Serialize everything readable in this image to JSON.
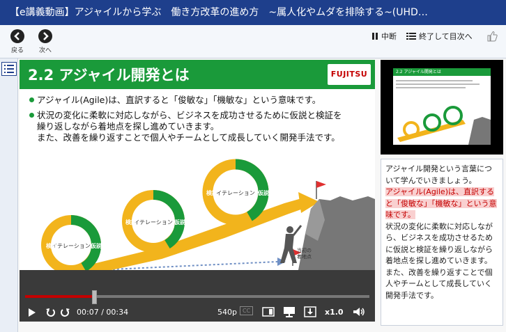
{
  "window": {
    "title": "【e講義動画】アジャイルから学ぶ　働き方改革の進め方　~属人化やムダを排除する~(UHD…"
  },
  "toolbar": {
    "back_label": "戻る",
    "next_label": "次へ",
    "pause_label": "中断",
    "toc_label": "終了して目次へ"
  },
  "slide": {
    "title": "2.2 アジャイル開発とは",
    "logo": "FUJITSU",
    "bullet1": "アジャイル(Agile)は、直訳すると「俊敏な」「機敏な」という意味です。",
    "bullet2_line1": "状況の変化に柔軟に対応しながら、ビジネスを成功させるために仮説と検証を",
    "bullet2_line2": "繰り返しながら着地点を探し進めていきます。",
    "bullet2_line3": "また、改善を繰り返すことで個人やチームとして成長していく開発手法です。",
    "loop_center": "イテレーション",
    "loop_left": "検証",
    "loop_right": "仮説",
    "goal_label_1": "当初の",
    "goal_label_2": "着地点"
  },
  "player": {
    "current_time": "00:07",
    "separator": " / ",
    "total_time": "00:34",
    "quality": "540p",
    "cc": "CC",
    "speed": "x1.0",
    "progress_fraction": 0.2
  },
  "transcript": {
    "line1": "アジャイル開発という言葉について学んでいきましょう。",
    "highlight": "アジャイル(Agile)は、直訳すると「俊敏な」「機敏な」という意味です。",
    "rest": "状況の変化に柔軟に対応しながら、ビジネスを成功させるために仮説と検証を繰り返しながら着地点を探し進めていきます。また、改善を繰り返すことで個人やチームとして成長していく開発手法です。"
  },
  "colors": {
    "header_blue": "#1e3f8c",
    "green": "#1a9a3a",
    "yellow": "#f2b41c",
    "red": "#c40000"
  }
}
